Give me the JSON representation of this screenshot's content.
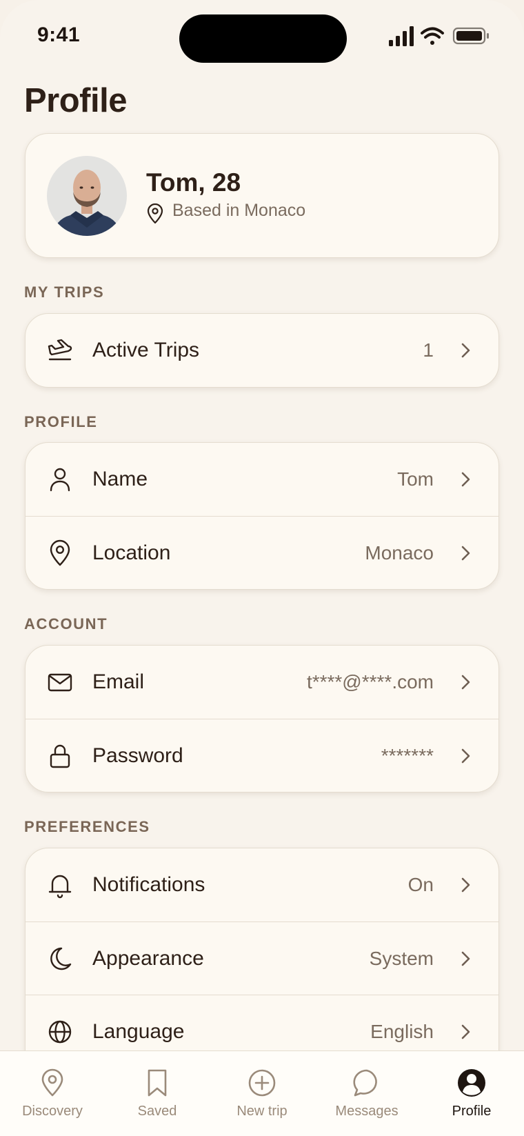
{
  "status": {
    "time": "9:41"
  },
  "page": {
    "title": "Profile"
  },
  "user": {
    "name_age": "Tom, 28",
    "location": "Based in Monaco"
  },
  "sections": {
    "my_trips": "MY TRIPS",
    "profile": "PROFILE",
    "account": "ACCOUNT",
    "preferences": "PREFERENCES"
  },
  "trips": {
    "active_label": "Active Trips",
    "active_count": "1"
  },
  "profile_rows": {
    "name_label": "Name",
    "name_value": "Tom",
    "location_label": "Location",
    "location_value": "Monaco"
  },
  "account_rows": {
    "email_label": "Email",
    "email_value": "t****@****.com",
    "password_label": "Password",
    "password_value": "*******"
  },
  "preference_rows": {
    "notifications_label": "Notifications",
    "notifications_value": "On",
    "appearance_label": "Appearance",
    "appearance_value": "System",
    "language_label": "Language",
    "language_value": "English"
  },
  "tabs": [
    {
      "label": "Discovery",
      "icon": "map-pin-icon",
      "active": false
    },
    {
      "label": "Saved",
      "icon": "bookmark-icon",
      "active": false
    },
    {
      "label": "New trip",
      "icon": "plus-circle-icon",
      "active": false
    },
    {
      "label": "Messages",
      "icon": "chat-bubble-icon",
      "active": false
    },
    {
      "label": "Profile",
      "icon": "profile-icon",
      "active": true
    }
  ],
  "colors": {
    "background": "#F8F3EC",
    "card": "#FDF9F2",
    "text_primary": "#2E2018",
    "text_secondary": "#7A6B5E",
    "section_label": "#7A6656",
    "tab_inactive": "#9A8A7A"
  }
}
